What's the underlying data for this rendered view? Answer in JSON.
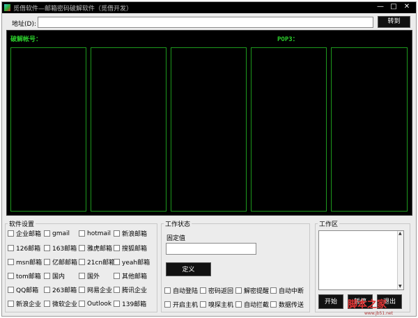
{
  "window": {
    "title": "觅借软件—邮箱密码破解软件（觅借开发）",
    "minimize": "—",
    "maximize": "□",
    "close": "✕"
  },
  "address": {
    "label": "地址(D):",
    "value": "",
    "go": "转到"
  },
  "crack": {
    "account_header": "破解帐号：",
    "pop3_header": "POP3："
  },
  "settings": {
    "title": "软件设置",
    "items": [
      "企业邮箱",
      "gmail",
      "hotmail",
      "新浪邮箱",
      "126邮箱",
      "163邮箱",
      "雅虎邮箱",
      "搜狐邮箱",
      "msn邮箱",
      "亿邮邮箱",
      "21cn邮箱",
      "yeah邮箱",
      "tom邮箱",
      "国内",
      "国外",
      "其他邮箱",
      "QQ邮箱",
      "263邮箱",
      "网易企业",
      "腾讯企业",
      "新浪企业",
      "微软企业",
      "Outlook",
      "139邮箱"
    ]
  },
  "status": {
    "title": "工作状态",
    "fixed_label": "固定值",
    "fixed_value": "",
    "define": "定义",
    "options": [
      "自动登陆",
      "密码返回",
      "解密提醒",
      "自动中断",
      "开启主机",
      "嗅探主机",
      "自动拦截",
      "数据传送"
    ]
  },
  "work": {
    "title": "工作区",
    "start": "开始",
    "pause": "暂停",
    "exit": "退出"
  },
  "watermark": {
    "text": "脚本之家",
    "url": "www.jb51.net"
  },
  "icons": {
    "app": "app-icon",
    "scroll_up": "scroll-up-icon",
    "scroll_down": "scroll-down-icon"
  }
}
